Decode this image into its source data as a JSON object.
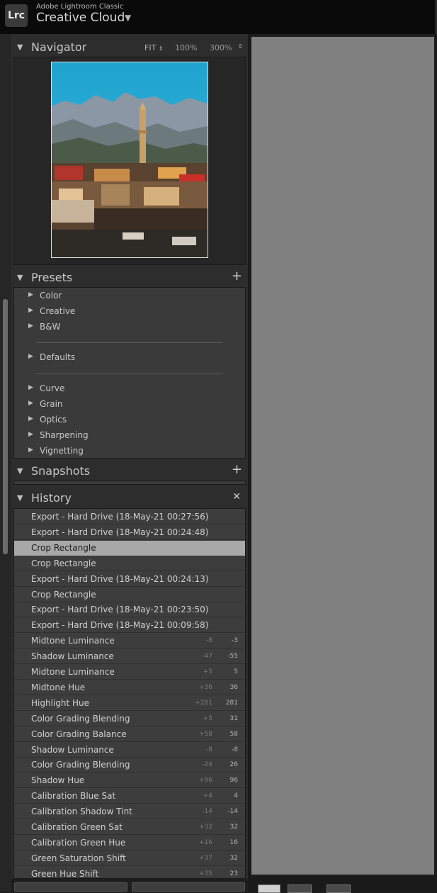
{
  "app": {
    "logo": "Lrc",
    "product": "Adobe Lightroom Classic",
    "account": "Creative Cloud",
    "menu_icon": "triangle-down-icon"
  },
  "navigator": {
    "title": "Navigator",
    "zoom_fit": "FIT",
    "zoom_100": "100%",
    "zoom_300": "300%"
  },
  "presets": {
    "title": "Presets",
    "groups": [
      {
        "label": "Color"
      },
      {
        "label": "Creative"
      },
      {
        "label": "B&W"
      },
      {
        "label": "Defaults"
      },
      {
        "label": "Curve"
      },
      {
        "label": "Grain"
      },
      {
        "label": "Optics"
      },
      {
        "label": "Sharpening"
      },
      {
        "label": "Vignetting"
      }
    ]
  },
  "snapshots": {
    "title": "Snapshots"
  },
  "history": {
    "title": "History",
    "items": [
      {
        "label": "Export - Hard Drive (18-May-21 00:27:56)",
        "delta": "",
        "value": ""
      },
      {
        "label": "Export - Hard Drive (18-May-21 00:24:48)",
        "delta": "",
        "value": ""
      },
      {
        "label": "Crop Rectangle",
        "delta": "",
        "value": "",
        "selected": true
      },
      {
        "label": "Crop Rectangle",
        "delta": "",
        "value": ""
      },
      {
        "label": "Export - Hard Drive (18-May-21 00:24:13)",
        "delta": "",
        "value": ""
      },
      {
        "label": "Crop Rectangle",
        "delta": "",
        "value": ""
      },
      {
        "label": "Export - Hard Drive (18-May-21 00:23:50)",
        "delta": "",
        "value": ""
      },
      {
        "label": "Export - Hard Drive (18-May-21 00:09:58)",
        "delta": "",
        "value": ""
      },
      {
        "label": "Midtone Luminance",
        "delta": "-8",
        "value": "-3"
      },
      {
        "label": "Shadow Luminance",
        "delta": "-47",
        "value": "-55"
      },
      {
        "label": "Midtone Luminance",
        "delta": "+5",
        "value": "5"
      },
      {
        "label": "Midtone Hue",
        "delta": "+36",
        "value": "36"
      },
      {
        "label": "Highlight Hue",
        "delta": "+281",
        "value": "281"
      },
      {
        "label": "Color Grading Blending",
        "delta": "+5",
        "value": "31"
      },
      {
        "label": "Color Grading Balance",
        "delta": "+58",
        "value": "58"
      },
      {
        "label": "Shadow Luminance",
        "delta": "-8",
        "value": "-8"
      },
      {
        "label": "Color Grading Blending",
        "delta": "-24",
        "value": "26"
      },
      {
        "label": "Shadow Hue",
        "delta": "+96",
        "value": "96"
      },
      {
        "label": "Calibration Blue Sat",
        "delta": "+4",
        "value": "4"
      },
      {
        "label": "Calibration Shadow Tint",
        "delta": "-14",
        "value": "-14"
      },
      {
        "label": "Calibration Green Sat",
        "delta": "+32",
        "value": "32"
      },
      {
        "label": "Calibration Green Hue",
        "delta": "+16",
        "value": "16"
      },
      {
        "label": "Green Saturation Shift",
        "delta": "+37",
        "value": "32"
      },
      {
        "label": "Green Hue Shift",
        "delta": "+35",
        "value": "23"
      }
    ]
  },
  "colors": {
    "panel_bg": "#2d2d2d",
    "list_bg": "#3d3d3d",
    "selected_row": "#a8a8a8",
    "main_view": "#808080"
  }
}
